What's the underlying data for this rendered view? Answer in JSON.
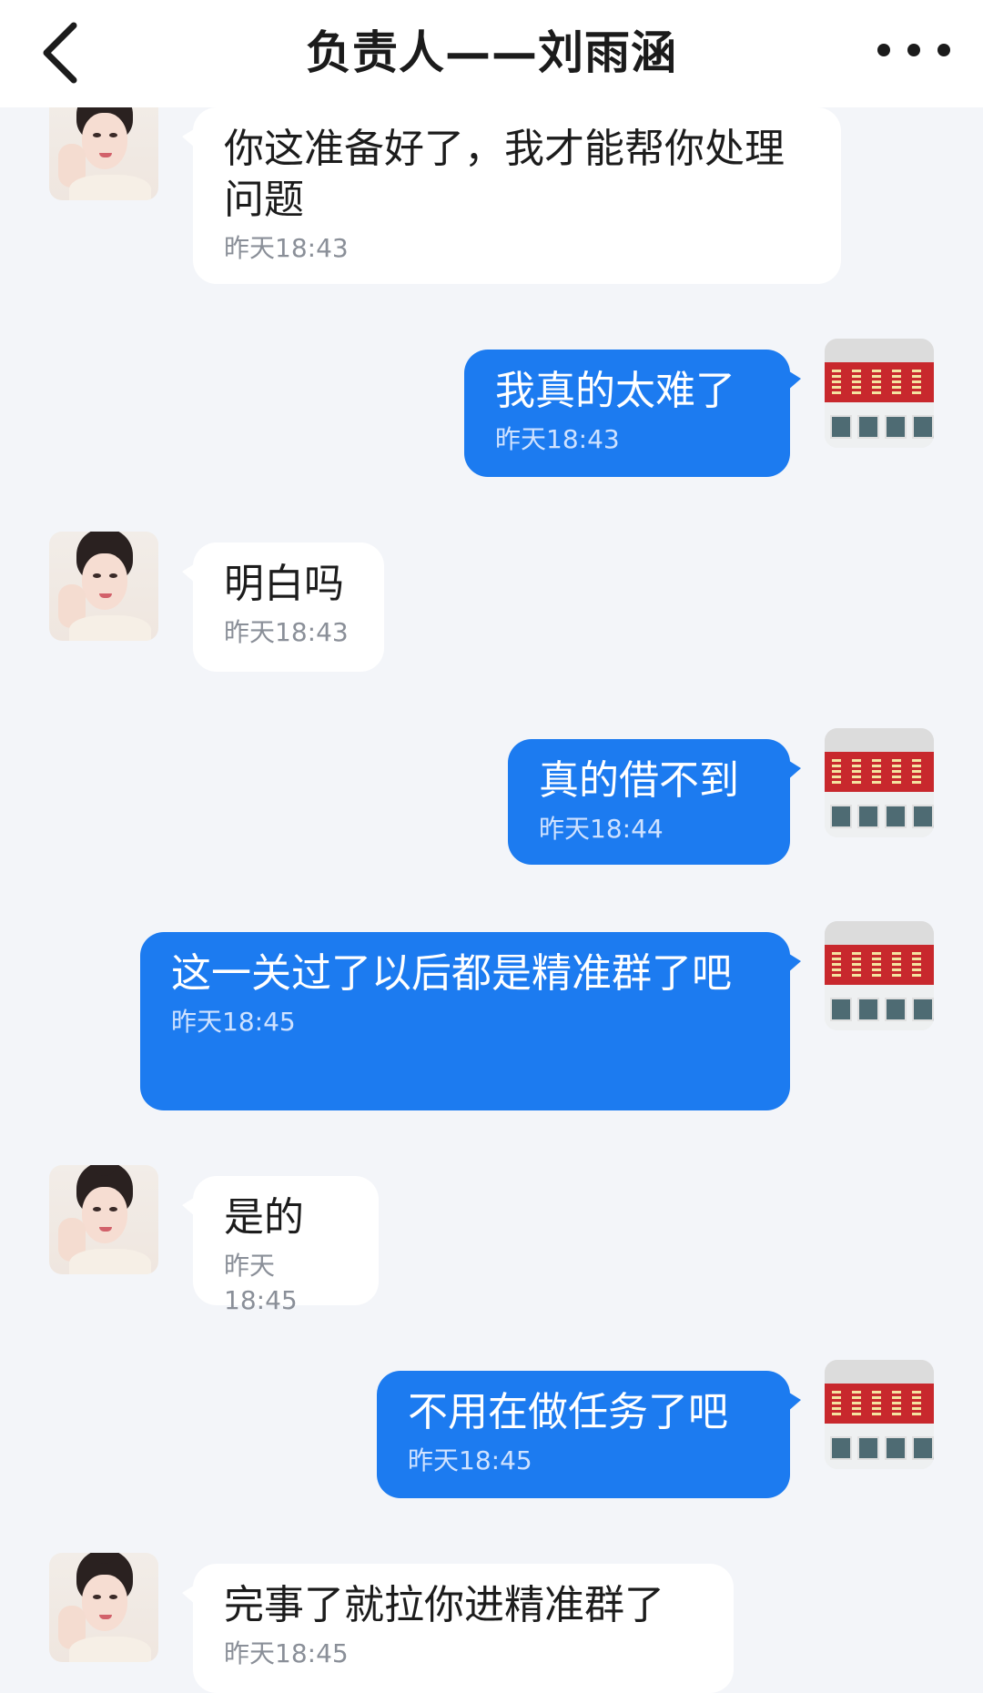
{
  "header": {
    "title": "负责人——刘雨涵",
    "back_icon": "chevron-left-icon",
    "more_icon": "more-dots-icon"
  },
  "colors": {
    "outgoing_bubble": "#1c7bf0",
    "incoming_bubble": "#ffffff",
    "background": "#f3f5f9"
  },
  "messages": [
    {
      "side": "in",
      "text": "你这准备好了，我才能帮你处理问题",
      "time": "昨天18:43"
    },
    {
      "side": "out",
      "text": "我真的太难了",
      "time": "昨天18:43"
    },
    {
      "side": "in",
      "text": "明白吗",
      "time": "昨天18:43"
    },
    {
      "side": "out",
      "text": "真的借不到",
      "time": "昨天18:44"
    },
    {
      "side": "out",
      "text": "这一关过了以后都是精准群了吧",
      "time": "昨天18:45"
    },
    {
      "side": "in",
      "text": "是的",
      "time": "昨天18:45"
    },
    {
      "side": "out",
      "text": "不用在做任务了吧",
      "time": "昨天18:45"
    },
    {
      "side": "in",
      "text": "完事了就拉你进精准群了",
      "time": "昨天18:45"
    }
  ]
}
